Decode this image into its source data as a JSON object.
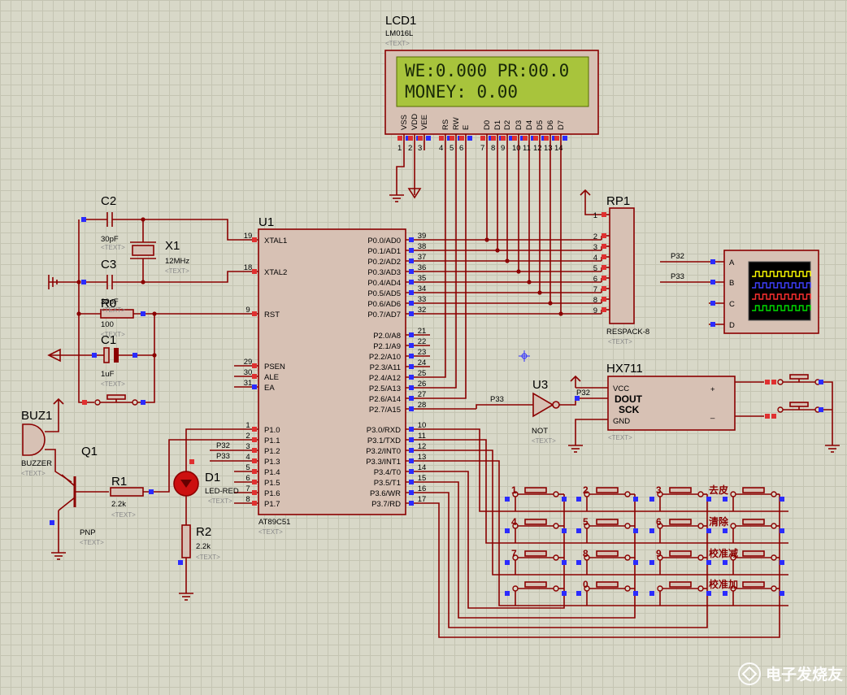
{
  "lcd": {
    "ref": "LCD1",
    "model": "LM016L",
    "text_tag": "<TEXT>",
    "line1": "WE:0.000 PR:00.0",
    "line2": "MONEY:  0.00",
    "pin_labels": [
      "VSS",
      "VDD",
      "VEE",
      "RS",
      "RW",
      "E",
      "D0",
      "D1",
      "D2",
      "D3",
      "D4",
      "D5",
      "D6",
      "D7"
    ],
    "pin_numbers": [
      "1",
      "2",
      "3",
      "4",
      "5",
      "6",
      "7",
      "8",
      "9",
      "10",
      "11",
      "12",
      "13",
      "14"
    ]
  },
  "mcu": {
    "ref": "U1",
    "model": "AT89C51",
    "text_tag": "<TEXT>",
    "left_pins": [
      {
        "name": "XTAL1",
        "num": "19"
      },
      {
        "name": "XTAL2",
        "num": "18"
      },
      {
        "name": "RST",
        "num": "9"
      },
      {
        "name": "PSEN",
        "num": "29"
      },
      {
        "name": "ALE",
        "num": "30"
      },
      {
        "name": "EA",
        "num": "31"
      },
      {
        "name": "P1.0",
        "num": "1"
      },
      {
        "name": "P1.1",
        "num": "2"
      },
      {
        "name": "P1.2",
        "num": "3"
      },
      {
        "name": "P1.3",
        "num": "4"
      },
      {
        "name": "P1.4",
        "num": "5"
      },
      {
        "name": "P1.5",
        "num": "6"
      },
      {
        "name": "P1.6",
        "num": "7"
      },
      {
        "name": "P1.7",
        "num": "8"
      }
    ],
    "right_pins": [
      {
        "name": "P0.0/AD0",
        "num": "39"
      },
      {
        "name": "P0.1/AD1",
        "num": "38"
      },
      {
        "name": "P0.2/AD2",
        "num": "37"
      },
      {
        "name": "P0.3/AD3",
        "num": "36"
      },
      {
        "name": "P0.4/AD4",
        "num": "35"
      },
      {
        "name": "P0.5/AD5",
        "num": "34"
      },
      {
        "name": "P0.6/AD6",
        "num": "33"
      },
      {
        "name": "P0.7/AD7",
        "num": "32"
      },
      {
        "name": "P2.0/A8",
        "num": "21"
      },
      {
        "name": "P2.1/A9",
        "num": "22"
      },
      {
        "name": "P2.2/A10",
        "num": "23"
      },
      {
        "name": "P2.3/A11",
        "num": "24"
      },
      {
        "name": "P2.4/A12",
        "num": "25"
      },
      {
        "name": "P2.5/A13",
        "num": "26"
      },
      {
        "name": "P2.6/A14",
        "num": "27"
      },
      {
        "name": "P2.7/A15",
        "num": "28"
      },
      {
        "name": "P3.0/RXD",
        "num": "10"
      },
      {
        "name": "P3.1/TXD",
        "num": "11"
      },
      {
        "name": "P3.2/INT0",
        "num": "12"
      },
      {
        "name": "P3.3/INT1",
        "num": "13"
      },
      {
        "name": "P3.4/T0",
        "num": "14"
      },
      {
        "name": "P3.5/T1",
        "num": "15"
      },
      {
        "name": "P3.6/WR",
        "num": "16"
      },
      {
        "name": "P3.7/RD",
        "num": "17"
      }
    ]
  },
  "components": {
    "c2": {
      "ref": "C2",
      "value": "30pF",
      "tag": "<TEXT>"
    },
    "c3": {
      "ref": "C3",
      "value": "30pF",
      "tag": "<TEXT>"
    },
    "x1": {
      "ref": "X1",
      "value": "12MHz",
      "tag": "<TEXT>"
    },
    "r0": {
      "ref": "R0",
      "value": "100",
      "tag": "<TEXT>"
    },
    "c1": {
      "ref": "C1",
      "value": "1uF",
      "tag": "<TEXT>"
    },
    "buz": {
      "ref": "BUZ1",
      "value": "BUZZER",
      "tag": "<TEXT>"
    },
    "q1": {
      "ref": "Q1",
      "value": "PNP",
      "tag": "<TEXT>"
    },
    "r1": {
      "ref": "R1",
      "value": "2.2k",
      "tag": "<TEXT>"
    },
    "d1": {
      "ref": "D1",
      "value": "LED-RED",
      "tag": "<TEXT>"
    },
    "r2": {
      "ref": "R2",
      "value": "2.2k",
      "tag": "<TEXT>"
    },
    "rp1": {
      "ref": "RP1",
      "value": "RESPACK-8",
      "tag": "<TEXT>",
      "pins": [
        "1",
        "2",
        "3",
        "4",
        "5",
        "6",
        "7",
        "8",
        "9"
      ]
    },
    "u3": {
      "ref": "U3",
      "value": "NOT",
      "tag": "<TEXT>",
      "in_label": "P33",
      "out_label": "P32"
    },
    "hx711": {
      "ref": "HX711",
      "pins": [
        "VCC",
        "DOUT",
        "SCK",
        "GND"
      ],
      "plus": "+",
      "minus": "_",
      "tag": "<TEXT>"
    },
    "scope": {
      "channels": [
        "A",
        "B",
        "C",
        "D"
      ],
      "in_labels": [
        "P32",
        "P33"
      ],
      "trace_colors": [
        "#ffff00",
        "#4040ff",
        "#ff3030",
        "#00dd00"
      ]
    },
    "net_labels": {
      "p32": "P32",
      "p33": "P33"
    }
  },
  "keypad": {
    "labels": [
      [
        "1",
        "2",
        "3",
        "去皮"
      ],
      [
        "4",
        "5",
        "6",
        "清除"
      ],
      [
        "7",
        "8",
        "9",
        "校准减"
      ],
      [
        "",
        "0",
        "",
        "校准加"
      ]
    ]
  },
  "watermark": "电子发烧友"
}
